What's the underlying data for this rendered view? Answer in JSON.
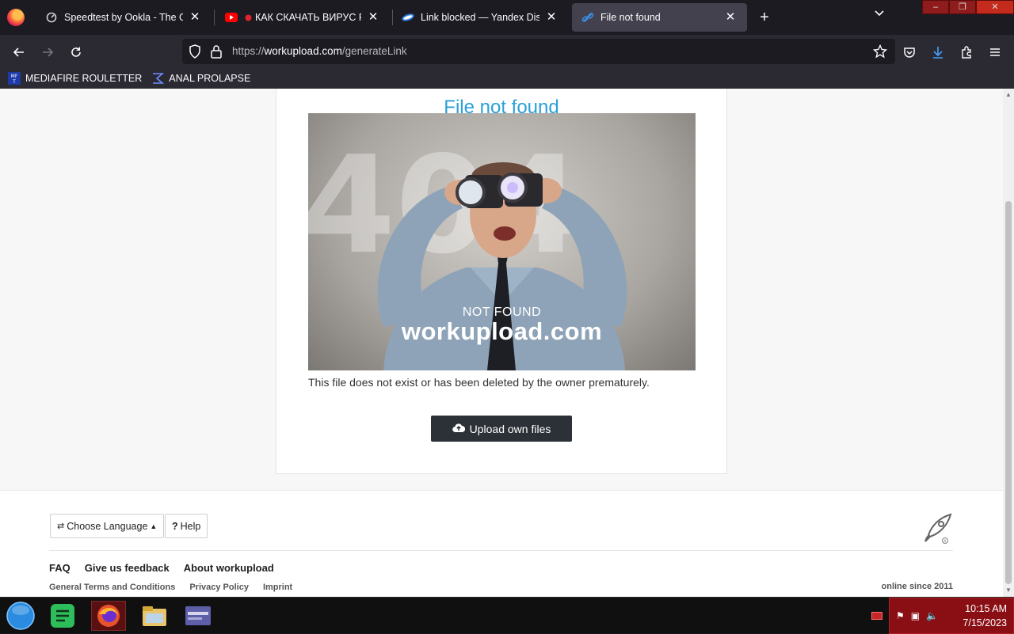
{
  "browser": {
    "tabs": [
      {
        "title": "Speedtest by Ookla - The Global Broadband Speed Test",
        "icon": "speedtest-icon"
      },
      {
        "title": "КАК СКАЧАТЬ ВИРУС Petya",
        "icon": "youtube-icon"
      },
      {
        "title": "Link blocked — Yandex Disk",
        "icon": "yandex-disk-icon"
      },
      {
        "title": "File not found",
        "icon": "link-icon",
        "active": true
      }
    ],
    "url": {
      "prefix": "https://",
      "host": "workupload.com",
      "path": "/generateLink"
    },
    "bookmarks": [
      {
        "label": "MEDIAFIRE ROULETTER",
        "icon": "mft-icon"
      },
      {
        "label": "ANAL PROLAPSE",
        "icon": "sigma-icon"
      }
    ]
  },
  "page": {
    "title": "File not found",
    "hero_overlay": {
      "big": "404",
      "caption": "NOT FOUND",
      "brand": "workupload.com"
    },
    "message": "This file does not exist or has been deleted by the owner prematurely.",
    "upload_button": "Upload own files"
  },
  "footer": {
    "language_button": "Choose Language",
    "help_button": "Help",
    "links": [
      "FAQ",
      "Give us feedback",
      "About workupload"
    ],
    "sublinks": [
      "General Terms and Conditions",
      "Privacy Policy",
      "Imprint"
    ],
    "since": "online since 2011"
  },
  "taskbar": {
    "time": "10:15 AM",
    "date": "7/15/2023"
  },
  "colors": {
    "accent": "#2aa0d8",
    "button_dark": "#2b3136",
    "tray_red": "#8a0f14"
  }
}
